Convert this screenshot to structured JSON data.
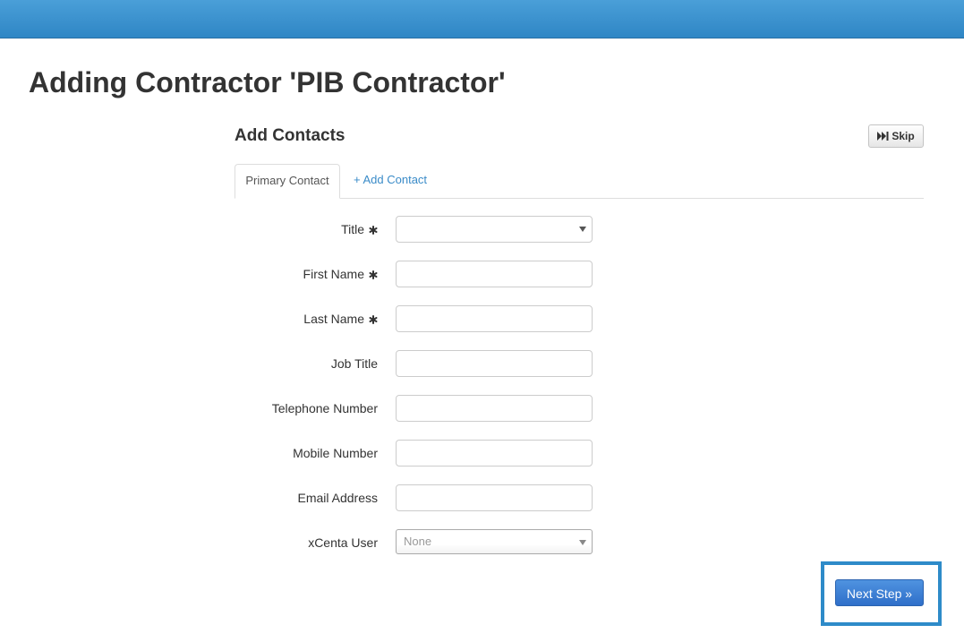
{
  "header": {
    "color": "#3a8fcd"
  },
  "page": {
    "title": "Adding Contractor 'PIB Contractor'"
  },
  "section": {
    "title": "Add Contacts",
    "skip_label": "Skip"
  },
  "tabs": [
    {
      "label": "Primary Contact",
      "active": true
    },
    {
      "label": "+ Add Contact",
      "active": false
    }
  ],
  "form": {
    "fields": [
      {
        "label": "Title",
        "required": true,
        "type": "select",
        "value": ""
      },
      {
        "label": "First Name",
        "required": true,
        "type": "text",
        "value": ""
      },
      {
        "label": "Last Name",
        "required": true,
        "type": "text",
        "value": ""
      },
      {
        "label": "Job Title",
        "required": false,
        "type": "text",
        "value": ""
      },
      {
        "label": "Telephone Number",
        "required": false,
        "type": "text",
        "value": ""
      },
      {
        "label": "Mobile Number",
        "required": false,
        "type": "text",
        "value": ""
      },
      {
        "label": "Email Address",
        "required": false,
        "type": "text",
        "value": ""
      },
      {
        "label": "xCenta User",
        "required": false,
        "type": "select",
        "value": "None"
      }
    ]
  },
  "actions": {
    "next_label": "Next Step »",
    "next_color": "#3a7fd5",
    "highlight_color": "#2e8bc9"
  }
}
